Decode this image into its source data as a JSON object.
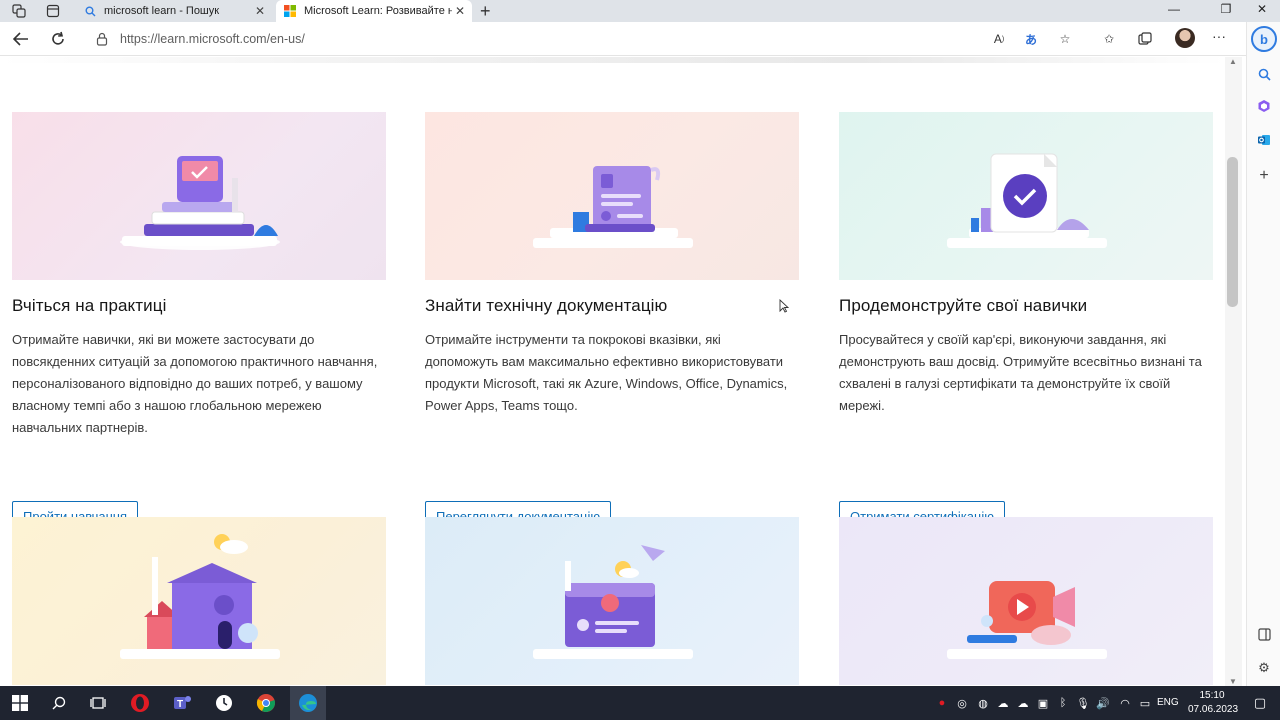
{
  "browser": {
    "tabs": [
      {
        "title": "microsoft learn - Пошук",
        "icon": "search-icon"
      },
      {
        "title": "Microsoft Learn: Розвивайте нав",
        "icon": "microsoft-logo-icon"
      }
    ],
    "url": "https://learn.microsoft.com/en-us/"
  },
  "cards": [
    {
      "title": "Вчіться на практиці",
      "description": "Отримайте навички, які ви можете застосувати до повсякденних ситуацій за допомогою практичного навчання, персоналізованого відповідно до ваших потреб, у вашому власному темпі або з нашою глобальною мережею навчальних партнерів.",
      "button": "Пройти навчання"
    },
    {
      "title": "Знайти технічну документацію",
      "description": "Отримайте інструменти та покрокові вказівки, які допоможуть вам максимально ефективно використовувати продукти Microsoft, такі як Azure, Windows, Office, Dynamics, Power Apps, Teams тощо.",
      "button": "Переглянути документацію"
    },
    {
      "title": "Продемонструйте свої навички",
      "description": "Просувайтеся у своїй кар'єрі, виконуючи завдання, які демонструють ваш досвід. Отримуйте всесвітньо визнані та схвалені в галузі сертифікати та демонструйте їх своїй мережі.",
      "button": "Отримати сертифікацію"
    }
  ],
  "taskbar": {
    "lang": "ENG",
    "time": "15:10",
    "date": "07.06.2023"
  },
  "colors": {
    "accent": "#0e6eb8",
    "illustration_purple": "#7b5cd6",
    "taskbar": "#1f2430"
  }
}
